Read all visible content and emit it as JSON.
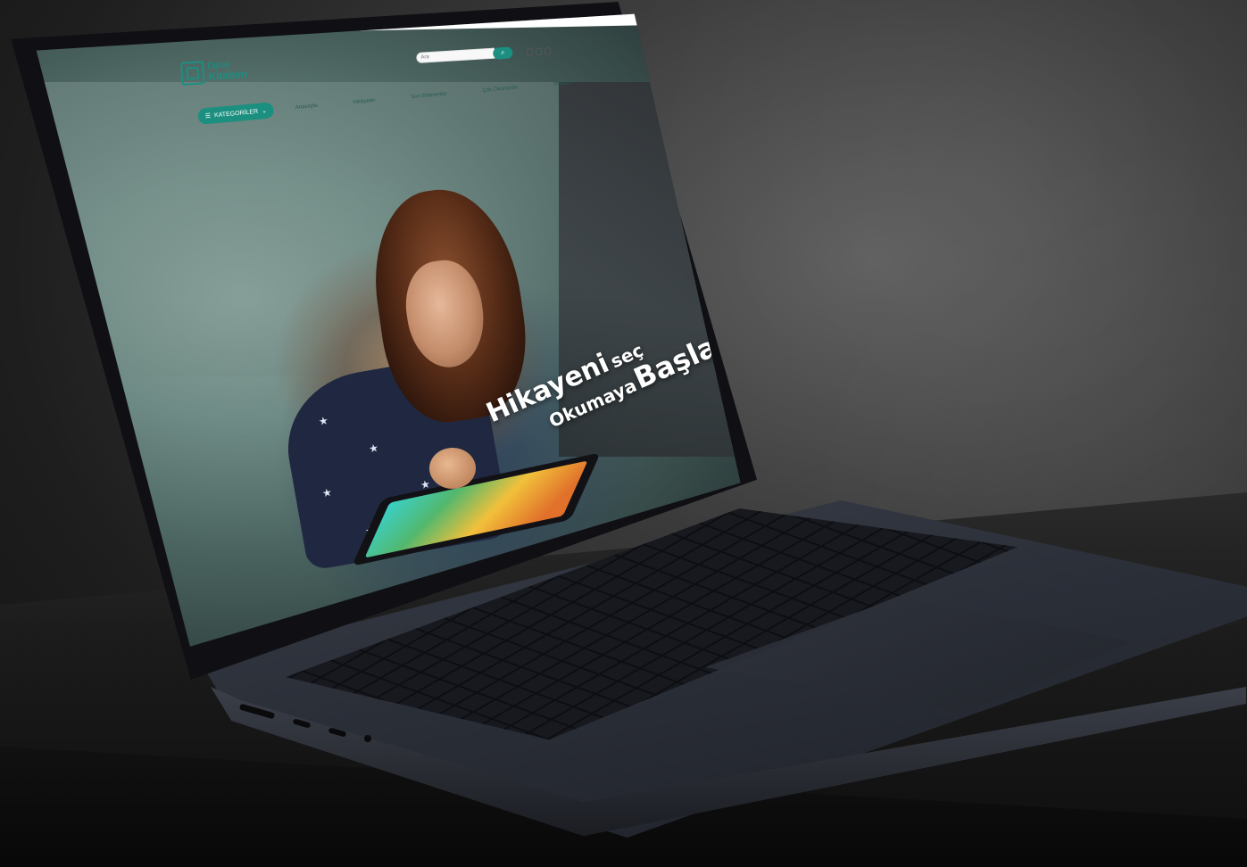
{
  "site": {
    "logo_line1": "Dijital",
    "logo_line2": "Kitabım",
    "search_placeholder": "Ara",
    "search_icon": "search-icon",
    "categories_label": "KATEGORİLER",
    "nav": [
      "Anasayfa",
      "Hikâyeler",
      "Son Eklenenler",
      "Çok Okunanlar",
      "İletişim"
    ],
    "accent_color": "#1b8f80"
  },
  "hero": {
    "slogan_word1": "Hikayeni",
    "slogan_word2": "seç",
    "slogan_word3": "Okumaya",
    "slogan_word4": "Başla"
  }
}
